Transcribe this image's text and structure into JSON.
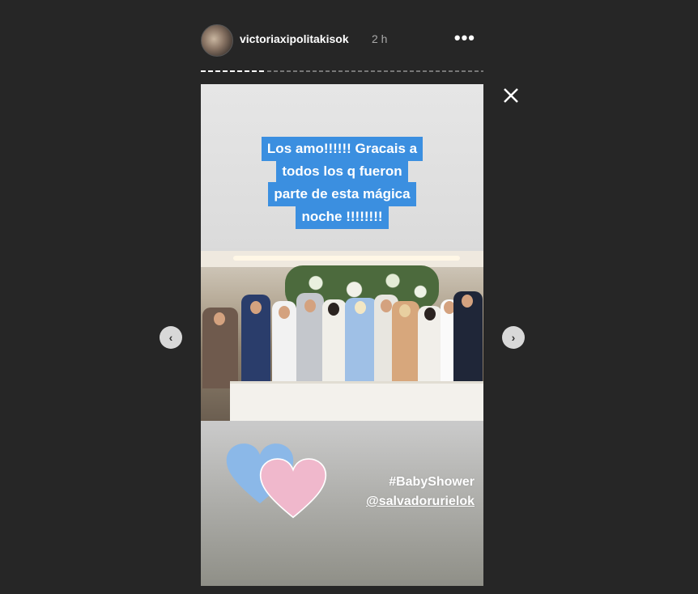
{
  "header": {
    "username": "victoriaxipolitakisok",
    "time_ago": "2 h",
    "more_label": "•••"
  },
  "controls": {
    "close_icon": "close-icon",
    "prev_icon": "chevron-left-icon",
    "next_icon": "chevron-right-icon",
    "prev_label": "‹",
    "next_label": "›"
  },
  "story": {
    "caption_lines": [
      "Los amo!!!!!! Gracais a",
      "todos los q fueron",
      "parte de esta mágica",
      "noche !!!!!!!!"
    ],
    "hashtag": "#BabyShower",
    "mention": "@salvadorurielok",
    "caption_bg": "#3b8fe0",
    "heart_blue": "#8bb8e8",
    "heart_pink": "#f0b8cc"
  },
  "progress": {
    "segments": 2,
    "current_segment": 1,
    "current_fraction": 0.23
  }
}
